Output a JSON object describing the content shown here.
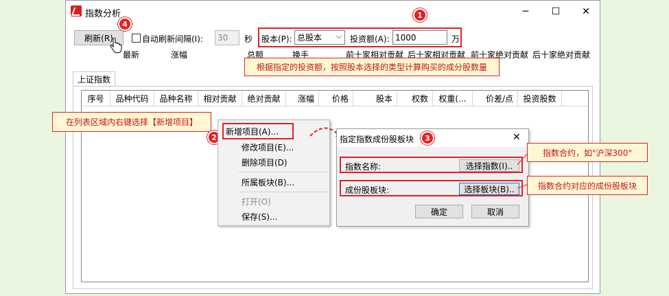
{
  "window": {
    "title": "指数分析",
    "min_icon": "─",
    "max_icon": "☐",
    "close_icon": "✕"
  },
  "toolbar": {
    "refresh_label": "刷新(R)",
    "auto_refresh_label": "自动刷新间隔(I):",
    "interval_value": "30",
    "interval_unit": "秒",
    "share_label": "股本(P):",
    "share_value": "总股本",
    "invest_label": "投资额(A):",
    "invest_value": "1000",
    "invest_unit": "万"
  },
  "stats": [
    "最新",
    "涨幅",
    "总额",
    "换手",
    "前十家相对贡献",
    "后十家相对贡献",
    "前十家绝对贡献",
    "后十家绝对贡献"
  ],
  "tab_label": "上证指数",
  "table": {
    "columns": [
      "序号",
      "品种代码",
      "品种名称",
      "相对贡献",
      "绝对贡献",
      "涨幅",
      "价格",
      "股本",
      "权数",
      "权重(...",
      "价差/点",
      "投资股数"
    ]
  },
  "context_menu": {
    "items": [
      "新增项目(A)...",
      "修改项目(E)...",
      "删除项目(D)",
      "所属板块(B)...",
      "打开(O)",
      "保存(S)..."
    ]
  },
  "dialog": {
    "title": "指定指数成份股板块",
    "index_label": "指数名称:",
    "index_button": "选择指数(I)..",
    "block_label": "成份股板块:",
    "block_button": "选择板块(B)..",
    "ok": "确定",
    "cancel": "取消",
    "close_icon": "✕"
  },
  "annotations": {
    "badges": [
      "1",
      "2",
      "3",
      "4"
    ],
    "callout_invest": "根据指定的投资额，按照股本选择的类型计算购买的成分股数量",
    "callout_add": "在列表区域内右键选择【新增项目】",
    "callout_index": "指数合约，如\"沪深300\"",
    "callout_block": "指数合约对应的成份股板块"
  },
  "colors": {
    "accent_red": "#e52020",
    "callout_bg": "#fdf7d3",
    "background": "#eaf6e0"
  }
}
